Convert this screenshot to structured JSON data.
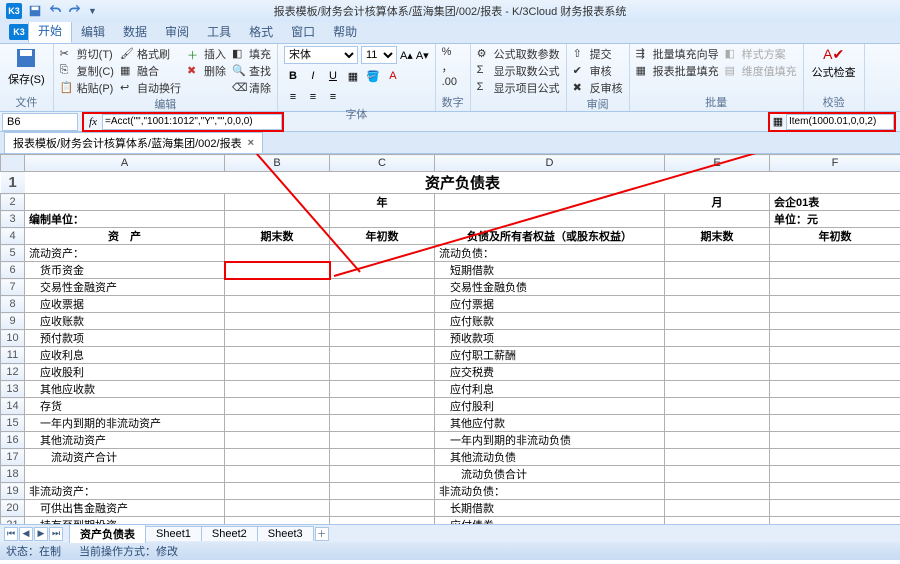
{
  "app": {
    "title": "报表模板/财务会计核算体系/蓝海集团/002/报表 - K/3Cloud 财务报表系统",
    "logo": "K3"
  },
  "tabs": {
    "start": "开始",
    "edit": "编辑",
    "data": "数据",
    "review": "审阅",
    "tools": "工具",
    "format": "格式",
    "window": "窗口",
    "help": "帮助"
  },
  "ribbon": {
    "save": "保存(S)",
    "file": "文件",
    "cut": "剪切(T)",
    "copy": "复制(C)",
    "paste": "粘贴(P)",
    "brush": "格式刷",
    "merge": "融合",
    "autowrap": "自动换行",
    "edit": "编辑",
    "insert": "插入",
    "delete": "删除",
    "fill": "填充",
    "find": "查找",
    "clear": "清除",
    "font": "字体",
    "fontname": "宋体",
    "fontsize": "11",
    "number": "数字",
    "fx_param": "公式取数参数",
    "show_fx": "显示取数公式",
    "show_item": "显示项目公式",
    "submit": "提交",
    "sk": "审核",
    "fk": "反审核",
    "review": "审阅",
    "batch_guide": "批量填充向导",
    "batch_fill": "报表批量填充",
    "batch": "批量",
    "style": "样式方案",
    "dim": "维度值填充",
    "fx_check": "公式检查",
    "check": "校验"
  },
  "namebox": "B6",
  "formula": "=Acct(\"\",\"1001:1012\",\"Y\",\"\",0,0,0)",
  "item_formula": "Item(1000.01,0,0,2)",
  "workbook_tab": "报表模板/财务会计核算体系/蓝海集团/002/报表",
  "cols": [
    "A",
    "B",
    "C",
    "D",
    "E",
    "F"
  ],
  "sheet": {
    "title": "资产负债表",
    "year_label": "年",
    "month_label": "月",
    "code": "会企01表",
    "unit_label": "编制单位：",
    "currency": "单位：元",
    "hdr": {
      "asset": "资　产",
      "endbal": "期末数",
      "begbal": "年初数",
      "liab": "负债及所有者权益（或股东权益）",
      "endbal2": "期末数",
      "begbal2": "年初数"
    },
    "rows": [
      [
        "流动资产：",
        "",
        "",
        "流动负债：",
        "",
        ""
      ],
      [
        "　货币资金",
        "",
        "",
        "　短期借款",
        "",
        ""
      ],
      [
        "　交易性金融资产",
        "",
        "",
        "　交易性金融负债",
        "",
        ""
      ],
      [
        "　应收票据",
        "",
        "",
        "　应付票据",
        "",
        ""
      ],
      [
        "　应收账款",
        "",
        "",
        "　应付账款",
        "",
        ""
      ],
      [
        "　预付款项",
        "",
        "",
        "　预收款项",
        "",
        ""
      ],
      [
        "　应收利息",
        "",
        "",
        "　应付职工薪酬",
        "",
        ""
      ],
      [
        "　应收股利",
        "",
        "",
        "　应交税费",
        "",
        ""
      ],
      [
        "　其他应收款",
        "",
        "",
        "　应付利息",
        "",
        ""
      ],
      [
        "　存货",
        "",
        "",
        "　应付股利",
        "",
        ""
      ],
      [
        "　一年内到期的非流动资产",
        "",
        "",
        "　其他应付款",
        "",
        ""
      ],
      [
        "　其他流动资产",
        "",
        "",
        "　一年内到期的非流动负债",
        "",
        ""
      ],
      [
        "　　流动资产合计",
        "",
        "",
        "　其他流动负债",
        "",
        ""
      ],
      [
        "",
        "",
        "",
        "　　流动负债合计",
        "",
        ""
      ],
      [
        "非流动资产：",
        "",
        "",
        "非流动负债：",
        "",
        ""
      ],
      [
        "　可供出售金融资产",
        "",
        "",
        "　长期借款",
        "",
        ""
      ],
      [
        "　持有至到期投资",
        "",
        "",
        "　应付债券",
        "",
        ""
      ]
    ]
  },
  "sheettabs": {
    "t1": "资产负债表",
    "t2": "Sheet1",
    "t3": "Sheet2",
    "t4": "Sheet3"
  },
  "status": {
    "state": "状态：在制",
    "mode": "当前操作方式：修改"
  }
}
